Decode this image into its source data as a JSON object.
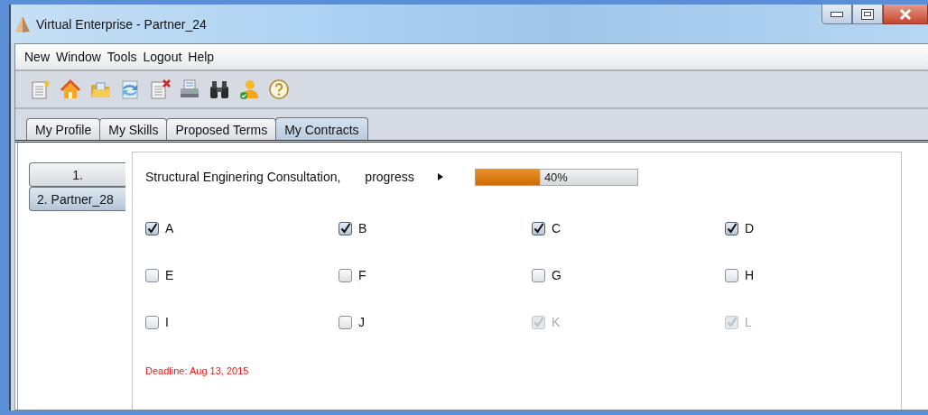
{
  "window": {
    "title": "Virtual Enterprise - Partner_24"
  },
  "menu": [
    "New",
    "Window",
    "Tools",
    "Logout",
    "Help"
  ],
  "tabs": [
    {
      "label": "My Profile",
      "selected": false
    },
    {
      "label": "My Skills",
      "selected": false
    },
    {
      "label": "Proposed Terms",
      "selected": false
    },
    {
      "label": "My Contracts",
      "selected": true
    }
  ],
  "contracts": [
    {
      "label": "1.",
      "selected": false
    },
    {
      "label": "2. Partner_28",
      "selected": true
    }
  ],
  "contract": {
    "title": "Structural Enginering Consultation,",
    "progress_label": "progress",
    "progress": {
      "level": 0.4,
      "reading": "40%"
    },
    "tasks": [
      {
        "label": "A",
        "checked": true,
        "disabled": false
      },
      {
        "label": "B",
        "checked": true,
        "disabled": false
      },
      {
        "label": "C",
        "checked": true,
        "disabled": false
      },
      {
        "label": "D",
        "checked": true,
        "disabled": false
      },
      {
        "label": "E",
        "checked": false,
        "disabled": false
      },
      {
        "label": "F",
        "checked": false,
        "disabled": false
      },
      {
        "label": "G",
        "checked": false,
        "disabled": false
      },
      {
        "label": "H",
        "checked": false,
        "disabled": false
      },
      {
        "label": "I",
        "checked": false,
        "disabled": false
      },
      {
        "label": "J",
        "checked": false,
        "disabled": false
      },
      {
        "label": "K",
        "checked": true,
        "disabled": true
      },
      {
        "label": "L",
        "checked": true,
        "disabled": true
      }
    ],
    "deadline": "Deadline: Aug 13, 2015"
  }
}
